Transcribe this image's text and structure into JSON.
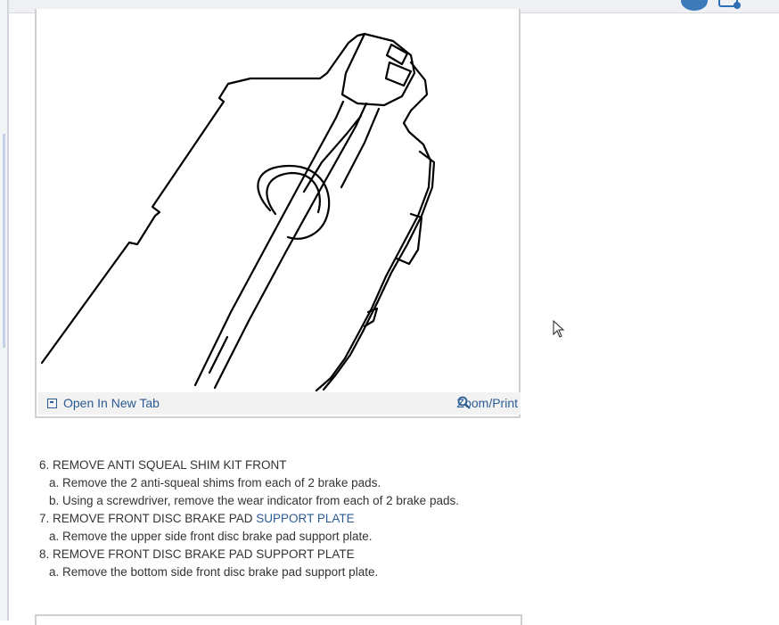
{
  "figure": {
    "open_in_new_tab": "Open In New Tab",
    "zoom_print": "Zoom/Print"
  },
  "procedure": {
    "step6": {
      "title": "6. REMOVE ANTI SQUEAL SHIM KIT FRONT",
      "a": "a. Remove the 2 anti-squeal shims from each of 2 brake pads.",
      "b": "b. Using a screwdriver, remove the wear indicator from each of 2 brake pads."
    },
    "step7": {
      "title_prefix": "7. REMOVE FRONT DISC BRAKE PAD ",
      "title_highlight": "SUPPORT PLATE",
      "a": "a. Remove the upper side front disc brake pad support plate."
    },
    "step8": {
      "title": "8. REMOVE FRONT DISC BRAKE PAD SUPPORT PLATE",
      "a": "a. Remove the bottom side front disc brake pad support plate."
    }
  },
  "icons": [
    "new-tab-icon",
    "zoom-icon",
    "avatar",
    "notification-icon",
    "mouse-cursor"
  ],
  "colors": {
    "link": "#2b5b94",
    "text": "#333333",
    "footer_bg": "#f2f2f2",
    "border": "#d0d0d0"
  }
}
